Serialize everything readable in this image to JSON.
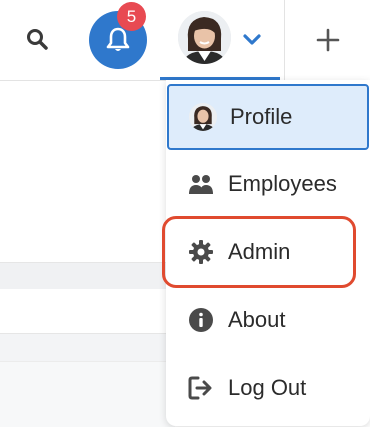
{
  "header": {
    "search_icon": "search-icon",
    "notifications": {
      "icon": "bell-icon",
      "badge_count": "5"
    },
    "user": {
      "avatar": "avatar",
      "chevron": "chevron-down-icon"
    },
    "add_icon": "plus-icon"
  },
  "user_menu": {
    "items": [
      {
        "label": "Profile",
        "icon": "avatar"
      },
      {
        "label": "Employees",
        "icon": "users-icon"
      },
      {
        "label": "Admin",
        "icon": "gear-icon"
      },
      {
        "label": "About",
        "icon": "info-icon"
      },
      {
        "label": "Log Out",
        "icon": "logout-icon"
      }
    ]
  },
  "colors": {
    "accent": "#2f78cc",
    "badge": "#e84a52",
    "selected_bg": "#deecfb",
    "highlight": "#e04a2f"
  }
}
